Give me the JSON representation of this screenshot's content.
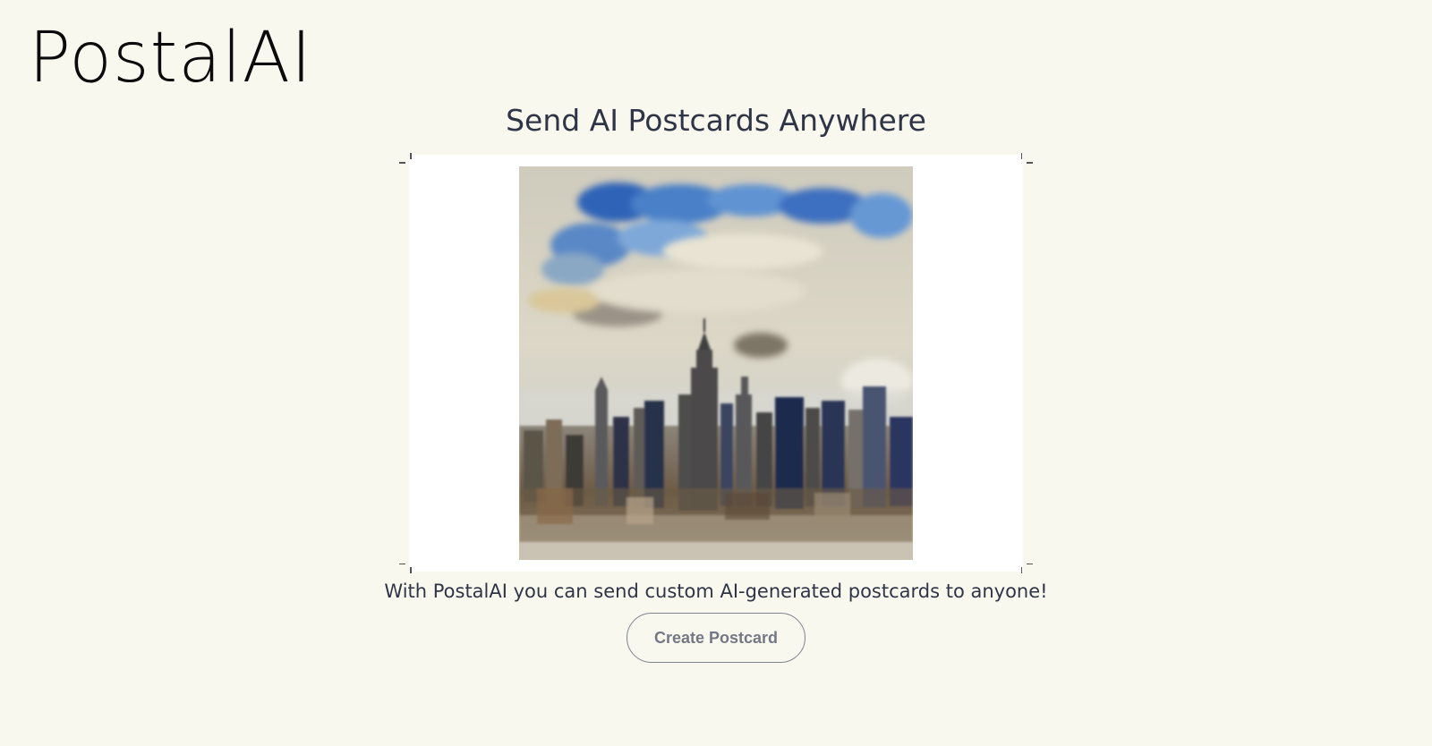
{
  "brand": {
    "logo_text": "PostalAI"
  },
  "hero": {
    "headline": "Send AI Postcards Anywhere",
    "tagline": "With PostalAI you can send custom AI-generated postcards to anyone!",
    "cta_label": "Create Postcard"
  },
  "postcard": {
    "image_subject": "painted-city-skyline-with-clouds",
    "frame_color": "#ffffff"
  },
  "colors": {
    "page_background": "#f9f8ef",
    "text": "#2f3546",
    "button_border": "#7f8590",
    "button_text": "#737884",
    "sky_blue": "#3f74c0"
  }
}
